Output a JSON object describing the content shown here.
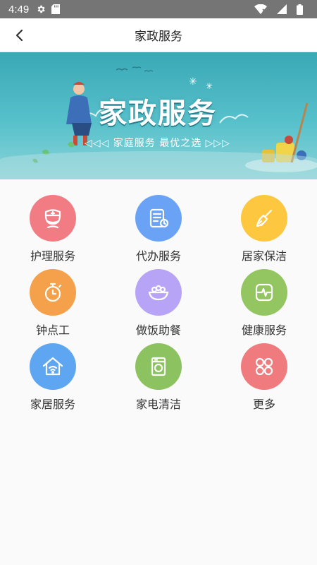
{
  "status_bar": {
    "time": "4:49"
  },
  "app_bar": {
    "title": "家政服务"
  },
  "banner": {
    "headline": "家政服务",
    "subtitle": "◁◁◁ 家庭服务  最优之选 ▷▷▷"
  },
  "services": [
    {
      "label": "护理服务",
      "icon": "nurse-icon",
      "color": "#f27c84"
    },
    {
      "label": "代办服务",
      "icon": "document-clock-icon",
      "color": "#6aa2f5"
    },
    {
      "label": "居家保洁",
      "icon": "broom-icon",
      "color": "#fdc840"
    },
    {
      "label": "钟点工",
      "icon": "stopwatch-icon",
      "color": "#f5a04a"
    },
    {
      "label": "做饭助餐",
      "icon": "food-bowl-icon",
      "color": "#b8a4f7"
    },
    {
      "label": "健康服务",
      "icon": "health-monitor-icon",
      "color": "#93c661"
    },
    {
      "label": "家居服务",
      "icon": "home-wifi-icon",
      "color": "#5ea6f2"
    },
    {
      "label": "家电清洁",
      "icon": "washing-machine-icon",
      "color": "#8cc25f"
    },
    {
      "label": "更多",
      "icon": "more-circles-icon",
      "color": "#f07b7e"
    }
  ]
}
